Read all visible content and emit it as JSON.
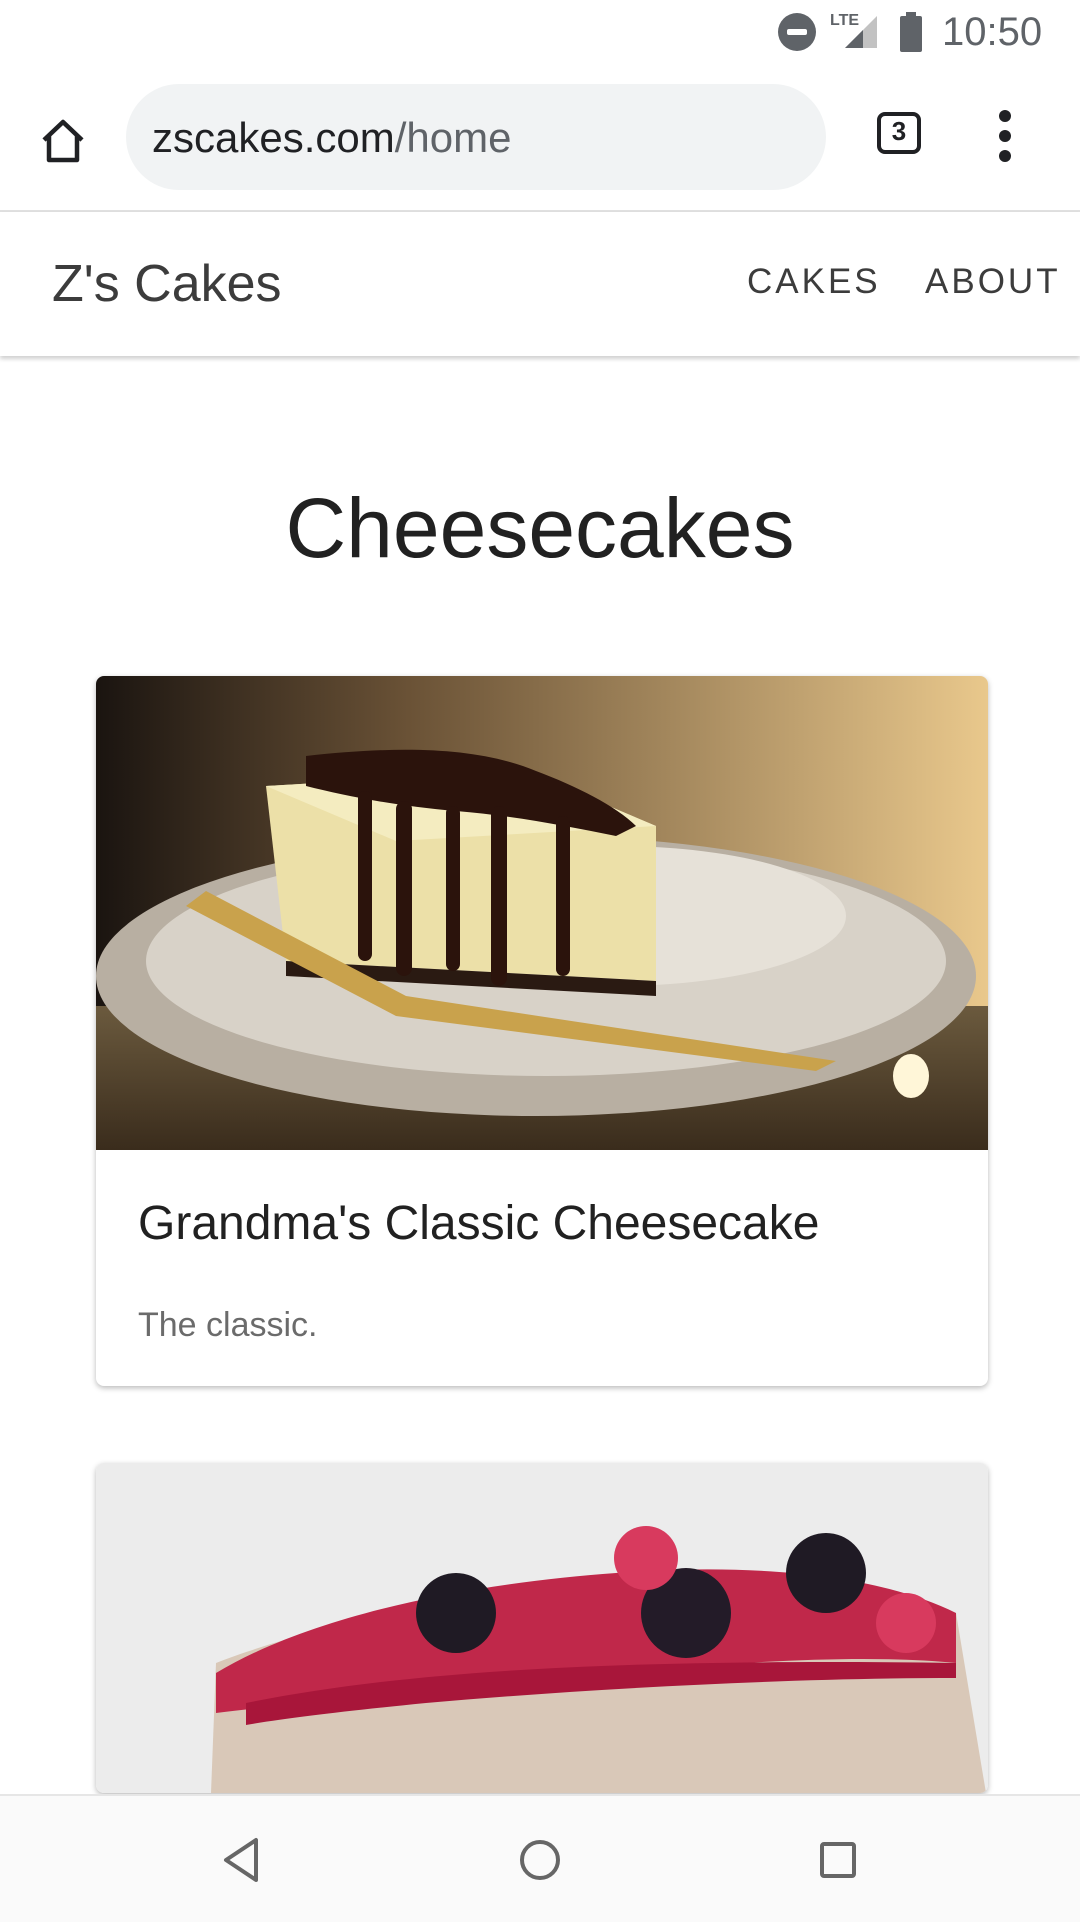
{
  "status_bar": {
    "network_label": "LTE",
    "time": "10:50",
    "icons": [
      "do-not-disturb-icon",
      "signal-icon",
      "battery-icon"
    ]
  },
  "browser": {
    "url_domain": "zscakes.com",
    "url_path": "/home",
    "tab_count": "3",
    "icons": [
      "home-icon",
      "tab-switcher-icon",
      "more-menu-icon"
    ]
  },
  "site": {
    "brand": "Z's Cakes",
    "nav": [
      "CAKES",
      "ABOUT"
    ]
  },
  "page": {
    "title": "Cheesecakes",
    "cards": [
      {
        "title": "Grandma's Classic Cheesecake",
        "description": "The classic.",
        "image": "cheesecake-chocolate-drizzle-photo"
      },
      {
        "image": "berry-cheesecake-photo"
      }
    ]
  },
  "system_nav": {
    "icons": [
      "back-icon",
      "home-circle-icon",
      "recents-icon"
    ]
  },
  "colors": {
    "chrome_bg": "#f1f3f4",
    "text": "#212121",
    "muted": "#6b6b6b"
  }
}
